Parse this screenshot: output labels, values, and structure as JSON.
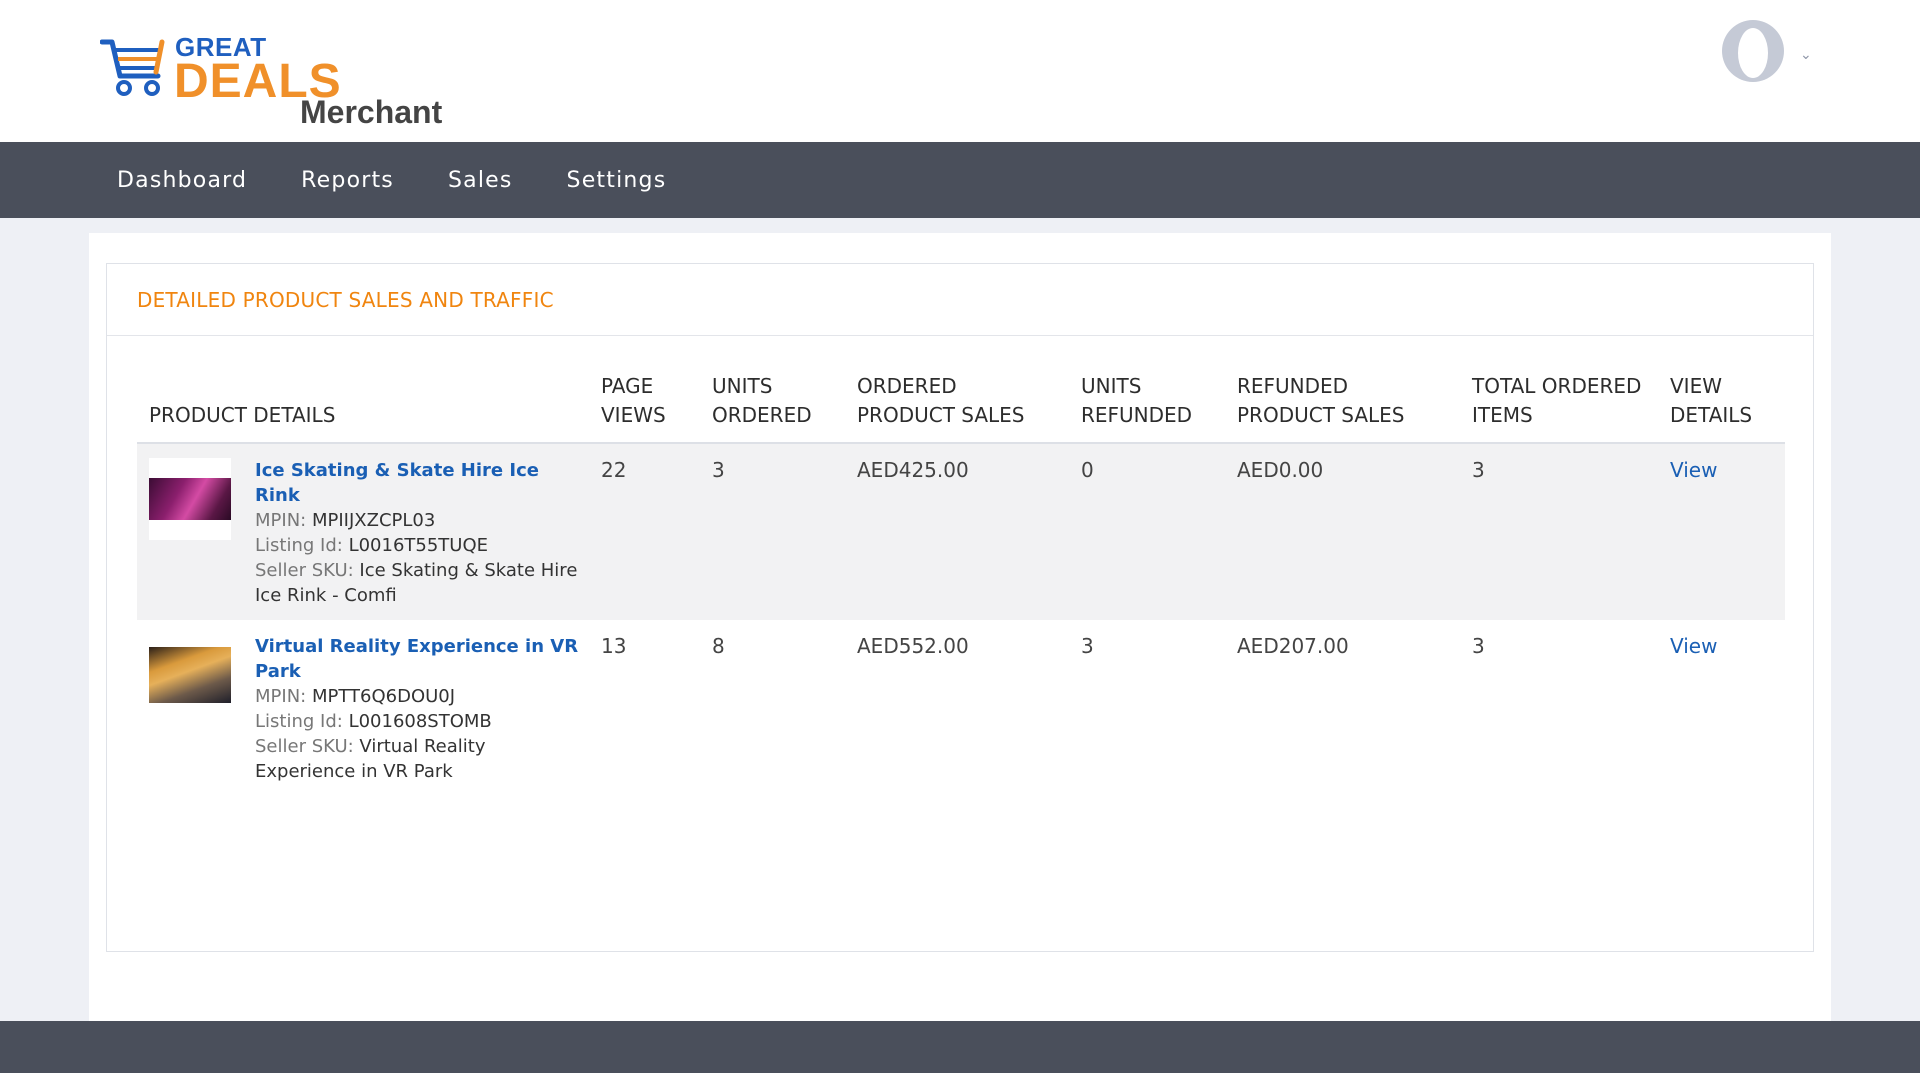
{
  "brand": {
    "logo_great": "GREAT",
    "logo_deals": "DEALS",
    "logo_merchant": "Merchant",
    "accent_orange": "#f0902a",
    "accent_blue": "#1f5fbf"
  },
  "header": {
    "avatar_icon": "user-avatar-icon",
    "chevron_icon": "chevron-down-icon",
    "chevron_glyph": "⌄"
  },
  "nav": {
    "items": [
      {
        "label": "Dashboard"
      },
      {
        "label": "Reports"
      },
      {
        "label": "Sales"
      },
      {
        "label": "Settings"
      }
    ]
  },
  "panel": {
    "title": "DETAILED PRODUCT SALES AND TRAFFIC"
  },
  "table": {
    "headers": {
      "product_details": "PRODUCT DETAILS",
      "page_views_1": "PAGE",
      "page_views_2": "VIEWS",
      "units_ordered_1": "UNITS",
      "units_ordered_2": "ORDERED",
      "ordered_sales_1": "ORDERED",
      "ordered_sales_2": "PRODUCT SALES",
      "units_refunded_1": "UNITS",
      "units_refunded_2": "REFUNDED",
      "refunded_sales_1": "REFUNDED",
      "refunded_sales_2": "PRODUCT SALES",
      "total_items_1": "TOTAL ORDERED",
      "total_items_2": "ITEMS",
      "view_details_1": "VIEW",
      "view_details_2": "DETAILS"
    },
    "labels": {
      "mpin": "MPIN:",
      "listing_id": "Listing Id:",
      "seller_sku": "Seller SKU:"
    },
    "rows": [
      {
        "name": "Ice Skating & Skate Hire Ice Rink",
        "mpin": "MPIIJXZCPL03",
        "listing_id": "L0016T55TUQE",
        "seller_sku": "Ice Skating & Skate Hire Ice Rink - Comfi",
        "page_views": "22",
        "units_ordered": "3",
        "ordered_sales": "AED425.00",
        "units_refunded": "0",
        "refunded_sales": "AED0.00",
        "total_items": "3",
        "view": "View"
      },
      {
        "name": "Virtual Reality Experience in VR Park",
        "mpin": "MPTT6Q6DOU0J",
        "listing_id": "L001608STOMB",
        "seller_sku": "Virtual Reality Experience in VR Park",
        "page_views": "13",
        "units_ordered": "8",
        "ordered_sales": "AED552.00",
        "units_refunded": "3",
        "refunded_sales": "AED207.00",
        "total_items": "3",
        "view": "View"
      }
    ]
  }
}
